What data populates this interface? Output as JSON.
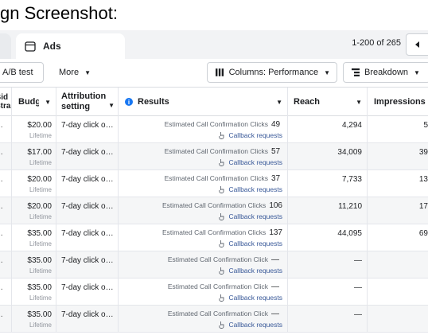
{
  "page_heading": "gn Screenshot:",
  "tabs": {
    "ads_label": "Ads"
  },
  "pagination": {
    "range_text": "1-200 of 265"
  },
  "toolbar": {
    "ab_test_label": "A/B test",
    "more_label": "More",
    "columns_label": "Columns: Performance",
    "breakdown_label": "Breakdown"
  },
  "columns": {
    "bid_strategy": "Bid\nStra",
    "budget": "Budget",
    "attribution": "Attribution setting",
    "results": "Results",
    "reach": "Reach",
    "impressions": "Impressions"
  },
  "rows": [
    {
      "bid": "…",
      "budget": "$20.00",
      "budget_sub": "Lifetime",
      "attribution": "7-day click o…",
      "result_metric": "Estimated Call Confirmation Clicks",
      "result_value": "49",
      "result_sub": "Callback requests",
      "reach": "4,294",
      "impressions": "5"
    },
    {
      "bid": "…",
      "budget": "$17.00",
      "budget_sub": "Lifetime",
      "attribution": "7-day click o…",
      "result_metric": "Estimated Call Confirmation Clicks",
      "result_value": "57",
      "result_sub": "Callback requests",
      "reach": "34,009",
      "impressions": "39"
    },
    {
      "bid": "…",
      "budget": "$20.00",
      "budget_sub": "Lifetime",
      "attribution": "7-day click o…",
      "result_metric": "Estimated Call Confirmation Clicks",
      "result_value": "37",
      "result_sub": "Callback requests",
      "reach": "7,733",
      "impressions": "13"
    },
    {
      "bid": "…",
      "budget": "$20.00",
      "budget_sub": "Lifetime",
      "attribution": "7-day click o…",
      "result_metric": "Estimated Call Confirmation Clicks",
      "result_value": "106",
      "result_sub": "Callback requests",
      "reach": "11,210",
      "impressions": "17"
    },
    {
      "bid": "…",
      "budget": "$35.00",
      "budget_sub": "Lifetime",
      "attribution": "7-day click o…",
      "result_metric": "Estimated Call Confirmation Clicks",
      "result_value": "137",
      "result_sub": "Callback requests",
      "reach": "44,095",
      "impressions": "69"
    },
    {
      "bid": "…",
      "budget": "$35.00",
      "budget_sub": "Lifetime",
      "attribution": "7-day click o…",
      "result_metric": "Estimated Call Confirmation Click",
      "result_value": "—",
      "result_sub": "Callback requests",
      "reach": "—",
      "impressions": ""
    },
    {
      "bid": "…",
      "budget": "$35.00",
      "budget_sub": "Lifetime",
      "attribution": "7-day click o…",
      "result_metric": "Estimated Call Confirmation Click",
      "result_value": "—",
      "result_sub": "Callback requests",
      "reach": "—",
      "impressions": ""
    },
    {
      "bid": "…",
      "budget": "$35.00",
      "budget_sub": "Lifetime",
      "attribution": "7-day click o…",
      "result_metric": "Estimated Call Confirmation Click",
      "result_value": "—",
      "result_sub": "Callback requests",
      "reach": "—",
      "impressions": ""
    }
  ],
  "icons": {
    "ads_tab": "ad-window-icon",
    "pager": "chevron-left-icon",
    "columns": "columns-icon",
    "breakdown": "breakdown-icon",
    "callback": "touch-hand-icon",
    "info": "info-icon"
  },
  "colors": {
    "accent": "#1877f2",
    "link": "#385898",
    "tab_bg": "#f2f3f5"
  }
}
